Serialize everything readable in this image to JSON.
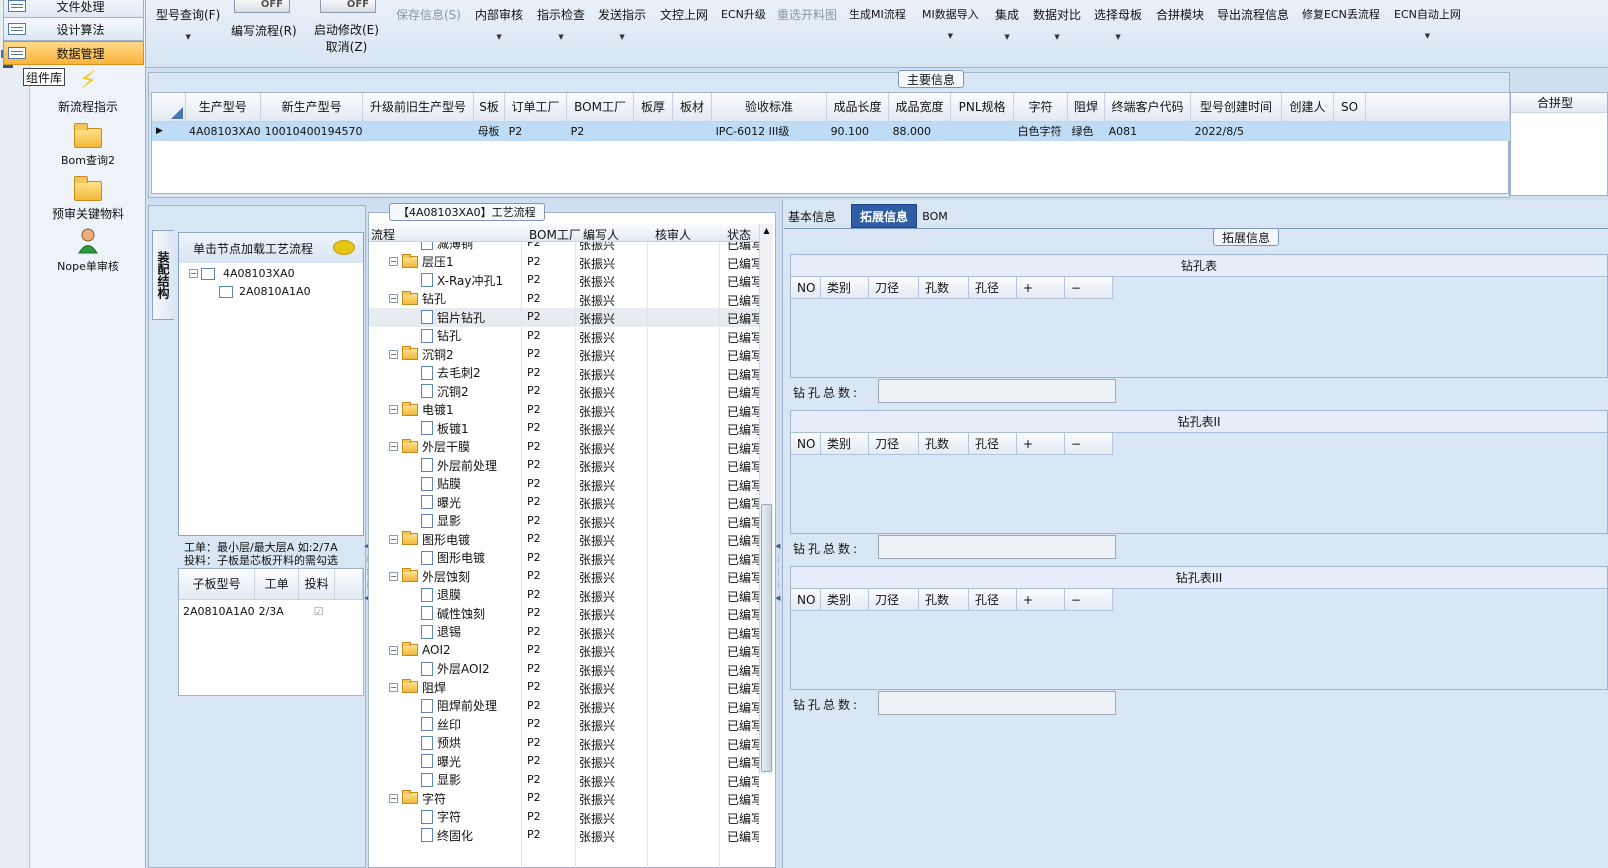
{
  "nav": {
    "tabs": [
      {
        "label": "文件处理",
        "active": false
      },
      {
        "label": "设计算法",
        "active": false
      },
      {
        "label": "数据管理",
        "active": true
      }
    ],
    "tooltip": "组件库",
    "items": [
      {
        "label": "新流程指示",
        "icon": "lightning-icon"
      },
      {
        "label": "Bom查询2",
        "icon": "folder-icon"
      },
      {
        "label": "预审关键物料",
        "icon": "folder-icon"
      },
      {
        "label": "Nope单审核",
        "icon": "user-icon"
      }
    ]
  },
  "toolbar": {
    "buttons": [
      {
        "label": "型号查询(F)",
        "enabled": true,
        "dropdown": true
      },
      {
        "label": "编写流程(R)",
        "enabled": true,
        "toggle": "OFF"
      },
      {
        "label": "启动修改(E)",
        "sub": "取消(Z)",
        "enabled": true,
        "toggle": "OFF"
      },
      {
        "label": "保存信息(S)",
        "enabled": false
      },
      {
        "label": "内部审核",
        "enabled": true,
        "dropdown": true
      },
      {
        "label": "指示检查",
        "enabled": true,
        "dropdown": true
      },
      {
        "label": "发送指示",
        "enabled": true,
        "dropdown": true
      },
      {
        "label": "文控上网",
        "enabled": true
      },
      {
        "label": "ECN升级",
        "enabled": true
      },
      {
        "label": "重选开料图",
        "enabled": false
      },
      {
        "label": "生成MI流程",
        "enabled": true
      },
      {
        "label": "MI数据导入",
        "enabled": true,
        "dropdown": true
      },
      {
        "label": "集成",
        "enabled": true,
        "dropdown": true
      },
      {
        "label": "数据对比",
        "enabled": true,
        "dropdown": true
      },
      {
        "label": "选择母板",
        "enabled": true,
        "dropdown": true
      },
      {
        "label": "合拼模块",
        "enabled": true
      },
      {
        "label": "导出流程信息",
        "enabled": true
      },
      {
        "label": "修复ECN丢流程",
        "enabled": true
      },
      {
        "label": "ECN自动上网",
        "enabled": true,
        "dropdown": true
      }
    ]
  },
  "main_info": {
    "title": "主要信息",
    "columns": [
      "生产型号",
      "新生产型号",
      "升级前旧生产型号",
      "S板",
      "订单工厂",
      "BOM工厂",
      "板厚",
      "板材",
      "验收标准",
      "成品长度",
      "成品宽度",
      "PNL规格",
      "字符",
      "阻焊",
      "终端客户代码",
      "型号创建时间",
      "创建人",
      "SO"
    ],
    "row": [
      "4A08103XA0",
      "10010400194570",
      "",
      "母板",
      "P2",
      "P2",
      "",
      "",
      "IPC-6012 III级",
      "90.100",
      "88.000",
      "",
      "白色字符",
      "绿色",
      "A081",
      "2022/8/5",
      "",
      ""
    ],
    "side_header": "合拼型"
  },
  "structure": {
    "vertical_tab": "装配结构",
    "hint": "单击节点加载工艺流程",
    "tree": [
      {
        "label": "4A08103XA0",
        "level": 0
      },
      {
        "label": "2A0810A1A0",
        "level": 1
      }
    ],
    "note1": "工单：最小层/最大层A 如:2/7A",
    "note2": "投料：子板是芯板开料的需勾选",
    "sub_columns": [
      "子板型号",
      "工单",
      "投料"
    ],
    "sub_rows": [
      [
        "2A0810A1A0",
        "2/3A",
        "☑"
      ]
    ]
  },
  "process": {
    "title": "【4A08103XA0】工艺流程",
    "columns": [
      "流程",
      "BOM工厂",
      "编写人",
      "核审人",
      "状态"
    ],
    "rows": [
      {
        "label": "减薄铜",
        "type": "doc",
        "level": 1,
        "factory": "P2",
        "author": "张振兴",
        "status": "已编写"
      },
      {
        "label": "层压1",
        "type": "folder",
        "level": 0,
        "factory": "P2",
        "author": "张振兴",
        "status": "已编写"
      },
      {
        "label": "X-Ray冲孔1",
        "type": "doc",
        "level": 1,
        "factory": "P2",
        "author": "张振兴",
        "status": "已编写"
      },
      {
        "label": "钻孔",
        "type": "folder",
        "level": 0,
        "factory": "P2",
        "author": "张振兴",
        "status": "已编写"
      },
      {
        "label": "铝片钻孔",
        "type": "doc",
        "level": 1,
        "factory": "P2",
        "author": "张振兴",
        "status": "已编写",
        "selected": true
      },
      {
        "label": "钻孔",
        "type": "doc",
        "level": 1,
        "factory": "P2",
        "author": "张振兴",
        "status": "已编写"
      },
      {
        "label": "沉铜2",
        "type": "folder",
        "level": 0,
        "factory": "P2",
        "author": "张振兴",
        "status": "已编写"
      },
      {
        "label": "去毛刺2",
        "type": "doc",
        "level": 1,
        "factory": "P2",
        "author": "张振兴",
        "status": "已编写"
      },
      {
        "label": "沉铜2",
        "type": "doc",
        "level": 1,
        "factory": "P2",
        "author": "张振兴",
        "status": "已编写"
      },
      {
        "label": "电镀1",
        "type": "folder",
        "level": 0,
        "factory": "P2",
        "author": "张振兴",
        "status": "已编写"
      },
      {
        "label": "板镀1",
        "type": "doc",
        "level": 1,
        "factory": "P2",
        "author": "张振兴",
        "status": "已编写"
      },
      {
        "label": "外层干膜",
        "type": "folder",
        "level": 0,
        "factory": "P2",
        "author": "张振兴",
        "status": "已编写"
      },
      {
        "label": "外层前处理",
        "type": "doc",
        "level": 1,
        "factory": "P2",
        "author": "张振兴",
        "status": "已编写"
      },
      {
        "label": "贴膜",
        "type": "doc",
        "level": 1,
        "factory": "P2",
        "author": "张振兴",
        "status": "已编写"
      },
      {
        "label": "曝光",
        "type": "doc",
        "level": 1,
        "factory": "P2",
        "author": "张振兴",
        "status": "已编写"
      },
      {
        "label": "显影",
        "type": "doc",
        "level": 1,
        "factory": "P2",
        "author": "张振兴",
        "status": "已编写"
      },
      {
        "label": "图形电镀",
        "type": "folder",
        "level": 0,
        "factory": "P2",
        "author": "张振兴",
        "status": "已编写"
      },
      {
        "label": "图形电镀",
        "type": "doc",
        "level": 1,
        "factory": "P2",
        "author": "张振兴",
        "status": "已编写"
      },
      {
        "label": "外层蚀刻",
        "type": "folder",
        "level": 0,
        "factory": "P2",
        "author": "张振兴",
        "status": "已编写"
      },
      {
        "label": "退膜",
        "type": "doc",
        "level": 1,
        "factory": "P2",
        "author": "张振兴",
        "status": "已编写"
      },
      {
        "label": "碱性蚀刻",
        "type": "doc",
        "level": 1,
        "factory": "P2",
        "author": "张振兴",
        "status": "已编写"
      },
      {
        "label": "退锡",
        "type": "doc",
        "level": 1,
        "factory": "P2",
        "author": "张振兴",
        "status": "已编写"
      },
      {
        "label": "AOI2",
        "type": "folder",
        "level": 0,
        "factory": "P2",
        "author": "张振兴",
        "status": "已编写"
      },
      {
        "label": "外层AOI2",
        "type": "doc",
        "level": 1,
        "factory": "P2",
        "author": "张振兴",
        "status": "已编写"
      },
      {
        "label": "阻焊",
        "type": "folder",
        "level": 0,
        "factory": "P2",
        "author": "张振兴",
        "status": "已编写"
      },
      {
        "label": "阻焊前处理",
        "type": "doc",
        "level": 1,
        "factory": "P2",
        "author": "张振兴",
        "status": "已编写"
      },
      {
        "label": "丝印",
        "type": "doc",
        "level": 1,
        "factory": "P2",
        "author": "张振兴",
        "status": "已编写"
      },
      {
        "label": "预烘",
        "type": "doc",
        "level": 1,
        "factory": "P2",
        "author": "张振兴",
        "status": "已编写"
      },
      {
        "label": "曝光",
        "type": "doc",
        "level": 1,
        "factory": "P2",
        "author": "张振兴",
        "status": "已编写"
      },
      {
        "label": "显影",
        "type": "doc",
        "level": 1,
        "factory": "P2",
        "author": "张振兴",
        "status": "已编写"
      },
      {
        "label": "字符",
        "type": "folder",
        "level": 0,
        "factory": "P2",
        "author": "张振兴",
        "status": "已编写"
      },
      {
        "label": "字符",
        "type": "doc",
        "level": 1,
        "factory": "P2",
        "author": "张振兴",
        "status": "已编写"
      },
      {
        "label": "终固化",
        "type": "doc",
        "level": 1,
        "factory": "P2",
        "author": "张振兴",
        "status": "已编写"
      }
    ]
  },
  "detail": {
    "tabs": [
      {
        "label": "基本信息",
        "active": false
      },
      {
        "label": "拓展信息",
        "active": true
      },
      {
        "label": "BOM",
        "active": false
      }
    ],
    "group_title": "拓展信息",
    "drill_tables": [
      {
        "title": "钻孔表",
        "columns": [
          "NO",
          "类别",
          "刀径",
          "孔数",
          "孔径",
          "+",
          "−"
        ],
        "total_label": "钻孔总数:",
        "total_value": ""
      },
      {
        "title": "钻孔表II",
        "columns": [
          "NO",
          "类别",
          "刀径",
          "孔数",
          "孔径",
          "+",
          "−"
        ],
        "total_label": "钻孔总数:",
        "total_value": ""
      },
      {
        "title": "钻孔表III",
        "columns": [
          "NO",
          "类别",
          "刀径",
          "孔数",
          "孔径",
          "+",
          "−"
        ],
        "total_label": "钻孔总数:",
        "total_value": ""
      }
    ]
  },
  "colors": {
    "accent": "#f8b53b",
    "selection": "#bfdcf7",
    "active_tab": "#2f5ea5"
  }
}
